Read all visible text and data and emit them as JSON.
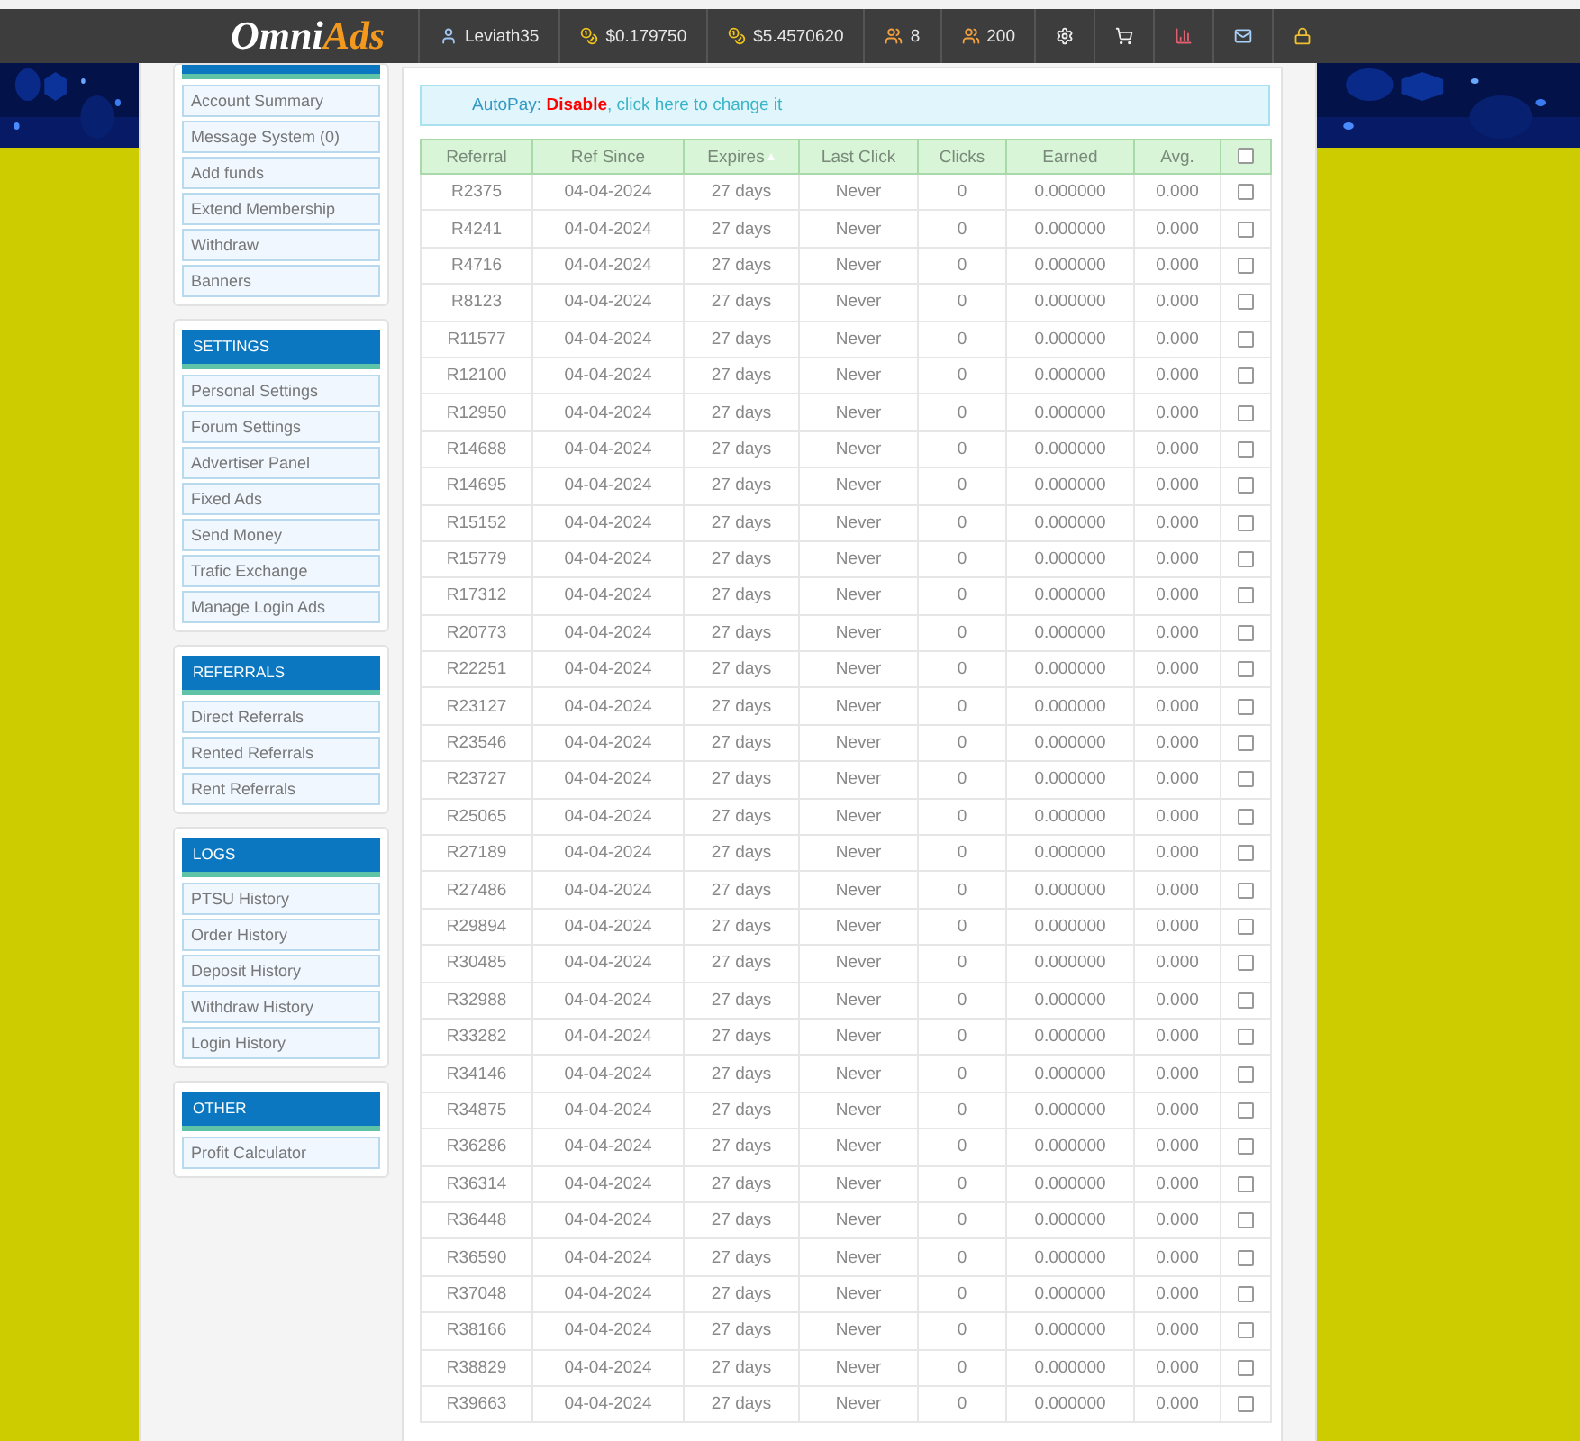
{
  "topbar": {
    "logo": {
      "main": "Omni",
      "accent": "Ads"
    },
    "items": [
      {
        "kind": "user",
        "text": "Leviath35"
      },
      {
        "kind": "coins",
        "text": "$0.179750"
      },
      {
        "kind": "coins",
        "text": "$5.4570620"
      },
      {
        "kind": "users",
        "text": "8"
      },
      {
        "kind": "users",
        "text": "200"
      },
      {
        "kind": "settings"
      },
      {
        "kind": "cart"
      },
      {
        "kind": "chart"
      },
      {
        "kind": "mail"
      },
      {
        "kind": "lock"
      }
    ]
  },
  "sidebar": {
    "sections": [
      {
        "items": [
          "Account Summary",
          "Message System (0)",
          "Add funds",
          "Extend Membership",
          "Withdraw",
          "Banners"
        ]
      },
      {
        "title": "SETTINGS",
        "items": [
          "Personal Settings",
          "Forum Settings",
          "Advertiser Panel",
          "Fixed Ads",
          "Send Money",
          "Trafic Exchange",
          "Manage Login Ads"
        ]
      },
      {
        "title": "REFERRALS",
        "items": [
          "Direct Referrals",
          "Rented Referrals",
          "Rent Referrals"
        ]
      },
      {
        "title": "LOGS",
        "items": [
          "PTSU History",
          "Order History",
          "Deposit History",
          "Withdraw History",
          "Login History"
        ]
      },
      {
        "title": "OTHER",
        "items": [
          "Profit Calculator"
        ]
      }
    ]
  },
  "autopay": {
    "label": "AutoPay:",
    "status": "Disable",
    "link": ", click here to change it"
  },
  "table": {
    "columns": [
      {
        "label": "Referral",
        "sorted": false
      },
      {
        "label": "Ref Since",
        "sorted": false
      },
      {
        "label": "Expires",
        "sorted": true
      },
      {
        "label": "Last Click",
        "sorted": false
      },
      {
        "label": "Clicks",
        "sorted": false
      },
      {
        "label": "Earned",
        "sorted": false
      },
      {
        "label": "Avg.",
        "sorted": false
      }
    ],
    "select_all": {
      "checked": false
    },
    "rows": [
      {
        "cells": [
          "R2375",
          "04-04-2024",
          "27 days",
          "Never",
          "0",
          "0.000000",
          "0.000"
        ],
        "checked": false
      },
      {
        "cells": [
          "R4241",
          "04-04-2024",
          "27 days",
          "Never",
          "0",
          "0.000000",
          "0.000"
        ],
        "checked": false
      },
      {
        "cells": [
          "R4716",
          "04-04-2024",
          "27 days",
          "Never",
          "0",
          "0.000000",
          "0.000"
        ],
        "checked": false
      },
      {
        "cells": [
          "R8123",
          "04-04-2024",
          "27 days",
          "Never",
          "0",
          "0.000000",
          "0.000"
        ],
        "checked": false
      },
      {
        "cells": [
          "R11577",
          "04-04-2024",
          "27 days",
          "Never",
          "0",
          "0.000000",
          "0.000"
        ],
        "checked": false
      },
      {
        "cells": [
          "R12100",
          "04-04-2024",
          "27 days",
          "Never",
          "0",
          "0.000000",
          "0.000"
        ],
        "checked": false
      },
      {
        "cells": [
          "R12950",
          "04-04-2024",
          "27 days",
          "Never",
          "0",
          "0.000000",
          "0.000"
        ],
        "checked": false
      },
      {
        "cells": [
          "R14688",
          "04-04-2024",
          "27 days",
          "Never",
          "0",
          "0.000000",
          "0.000"
        ],
        "checked": false
      },
      {
        "cells": [
          "R14695",
          "04-04-2024",
          "27 days",
          "Never",
          "0",
          "0.000000",
          "0.000"
        ],
        "checked": false
      },
      {
        "cells": [
          "R15152",
          "04-04-2024",
          "27 days",
          "Never",
          "0",
          "0.000000",
          "0.000"
        ],
        "checked": false
      },
      {
        "cells": [
          "R15779",
          "04-04-2024",
          "27 days",
          "Never",
          "0",
          "0.000000",
          "0.000"
        ],
        "checked": false
      },
      {
        "cells": [
          "R17312",
          "04-04-2024",
          "27 days",
          "Never",
          "0",
          "0.000000",
          "0.000"
        ],
        "checked": false
      },
      {
        "cells": [
          "R20773",
          "04-04-2024",
          "27 days",
          "Never",
          "0",
          "0.000000",
          "0.000"
        ],
        "checked": false
      },
      {
        "cells": [
          "R22251",
          "04-04-2024",
          "27 days",
          "Never",
          "0",
          "0.000000",
          "0.000"
        ],
        "checked": false
      },
      {
        "cells": [
          "R23127",
          "04-04-2024",
          "27 days",
          "Never",
          "0",
          "0.000000",
          "0.000"
        ],
        "checked": false
      },
      {
        "cells": [
          "R23546",
          "04-04-2024",
          "27 days",
          "Never",
          "0",
          "0.000000",
          "0.000"
        ],
        "checked": false
      },
      {
        "cells": [
          "R23727",
          "04-04-2024",
          "27 days",
          "Never",
          "0",
          "0.000000",
          "0.000"
        ],
        "checked": false
      },
      {
        "cells": [
          "R25065",
          "04-04-2024",
          "27 days",
          "Never",
          "0",
          "0.000000",
          "0.000"
        ],
        "checked": false
      },
      {
        "cells": [
          "R27189",
          "04-04-2024",
          "27 days",
          "Never",
          "0",
          "0.000000",
          "0.000"
        ],
        "checked": false
      },
      {
        "cells": [
          "R27486",
          "04-04-2024",
          "27 days",
          "Never",
          "0",
          "0.000000",
          "0.000"
        ],
        "checked": false
      },
      {
        "cells": [
          "R29894",
          "04-04-2024",
          "27 days",
          "Never",
          "0",
          "0.000000",
          "0.000"
        ],
        "checked": false
      },
      {
        "cells": [
          "R30485",
          "04-04-2024",
          "27 days",
          "Never",
          "0",
          "0.000000",
          "0.000"
        ],
        "checked": false
      },
      {
        "cells": [
          "R32988",
          "04-04-2024",
          "27 days",
          "Never",
          "0",
          "0.000000",
          "0.000"
        ],
        "checked": false
      },
      {
        "cells": [
          "R33282",
          "04-04-2024",
          "27 days",
          "Never",
          "0",
          "0.000000",
          "0.000"
        ],
        "checked": false
      },
      {
        "cells": [
          "R34146",
          "04-04-2024",
          "27 days",
          "Never",
          "0",
          "0.000000",
          "0.000"
        ],
        "checked": false
      },
      {
        "cells": [
          "R34875",
          "04-04-2024",
          "27 days",
          "Never",
          "0",
          "0.000000",
          "0.000"
        ],
        "checked": false
      },
      {
        "cells": [
          "R36286",
          "04-04-2024",
          "27 days",
          "Never",
          "0",
          "0.000000",
          "0.000"
        ],
        "checked": false
      },
      {
        "cells": [
          "R36314",
          "04-04-2024",
          "27 days",
          "Never",
          "0",
          "0.000000",
          "0.000"
        ],
        "checked": false
      },
      {
        "cells": [
          "R36448",
          "04-04-2024",
          "27 days",
          "Never",
          "0",
          "0.000000",
          "0.000"
        ],
        "checked": false
      },
      {
        "cells": [
          "R36590",
          "04-04-2024",
          "27 days",
          "Never",
          "0",
          "0.000000",
          "0.000"
        ],
        "checked": false
      },
      {
        "cells": [
          "R37048",
          "04-04-2024",
          "27 days",
          "Never",
          "0",
          "0.000000",
          "0.000"
        ],
        "checked": false
      },
      {
        "cells": [
          "R38166",
          "04-04-2024",
          "27 days",
          "Never",
          "0",
          "0.000000",
          "0.000"
        ],
        "checked": false
      },
      {
        "cells": [
          "R38829",
          "04-04-2024",
          "27 days",
          "Never",
          "0",
          "0.000000",
          "0.000"
        ],
        "checked": false
      },
      {
        "cells": [
          "R39663",
          "04-04-2024",
          "27 days",
          "Never",
          "0",
          "0.000000",
          "0.000"
        ],
        "checked": false
      }
    ]
  }
}
